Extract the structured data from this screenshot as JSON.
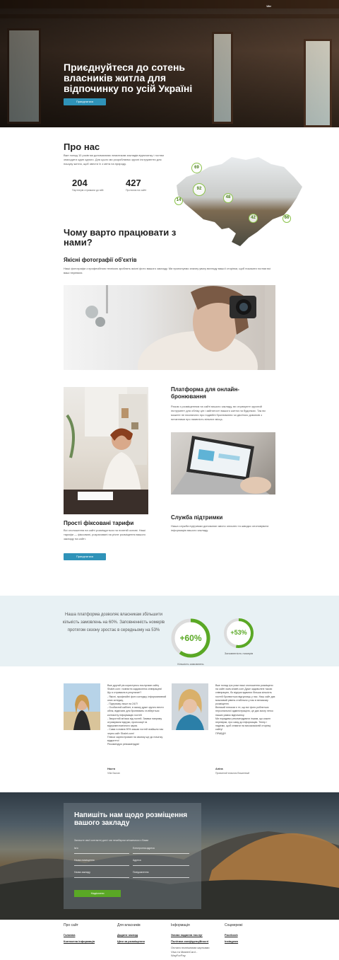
{
  "hero": {
    "lang": "Ukr",
    "title": "Приєднуйтеся до сотень власників житла для відпочинку по усій Україні",
    "button": "Приєднатися"
  },
  "about": {
    "title": "Про нас",
    "text": "Вже понад 10 років ми допомагаємо власникам закладів відпочинку і гостям знаходити один одного. Для цього ми розробляємо зручні інструменти для пошуку житла, щоб звести їх з мета на природу.",
    "stats": [
      {
        "num": "204",
        "label": "Партнерів отримали до війі"
      },
      {
        "num": "427",
        "label": "Протягом на сайті"
      }
    ],
    "map_bubbles": [
      "69",
      "92",
      "14",
      "48",
      "42",
      "66"
    ]
  },
  "why": {
    "title": "Чому варто працювати з нами?",
    "features": [
      {
        "title": "Якісні фотографії об'єктів",
        "text": "Наші фотографи з професійною технікою зроблять якісні фото вашого закладу. Ми пропонуємо значну увагу вигляду вашої сторінки, щоб показати гостям всі ваші переваги."
      },
      {
        "title": "Платформа для онлайн-бронювання",
        "text": "Разом з розміщенням на сайті вашого закладу, ви отримуєте зручний інструмент для обліку цін і зайнятості вашого житла на будинках. Так ви можете не вхиляпати про подвійні бронювання чи двоїткис дзвонків з питаннями про наявність вільних місць."
      },
      {
        "title": "Прості фіксовані тарифи",
        "text": "Всі оголошення на сайті розміщується на платній основі. Наші тарифи — фіксовані, розраховані на річне розміщення вашого закладу на сайті.",
        "button": "Приєднатися"
      },
      {
        "title": "Служба підтримки",
        "text": "Наша служба підтримки допомагає якісно описати та швидко опоновувати інформацію вашого закладу."
      }
    ]
  },
  "band": {
    "text": "Наша платформа дозволяє власникам збільшити кількість замовлень на 60%. Заповненність номерів протягом сезону зростає в середньому на 53%",
    "gauges": [
      {
        "value": "+60%",
        "fraction": 0.6,
        "caption": "Кількість замовлень"
      },
      {
        "value": "+53%",
        "fraction": 0.53,
        "caption": "Заповненість номерів"
      }
    ],
    "colors": {
      "accent": "#5aa825",
      "track": "#dcdcdc"
    }
  },
  "testimonials": [
    {
      "text": "Вже другий рік користуюсь послугами сайту Shalet.com і повністю задоволена співпрацею!\nЩо я отримала в результаті?\n- Якісні, професійні фото котеджу, інформативний опис котеджу,\n- Підтримку лише на 24/7!\n- Особистий кабінет, в якому дуже зручно вести облік, відвічати для бронювань та вберіться контактну інформацію гостей\n- Зворотній зв'язок від гостей. Заявки напряму отримували відгуки, пропозиції та відгукаєпломічного зараз.\n- Сама головна 90% зашаи гостей знайшли нас через сайт Shalet.com!\nПлюси зареєстровані на своєму ще до початку відкриття!\nРекомендую ревокмендую!",
      "name": "Настя",
      "role": "Villa Sacran"
    },
    {
      "text": "Вже понад три роки наші оголошення розміщено на сайті www.shalet.com Дуже задоволені такою співпрацею, бо відгуки вдачних більша кількість гостей бронюється відгуклиць у нас. Наш сайт дає можливий рівень стабільно у нас в великому розміщенні.\nВеликий плюсом є те, що всі фото робляться персональної адміністрацією, це дає змогу легко наших рамок відпочинку.\nМи порадимо рекомендувати іншим, що кожен перевіряє, про саму до інформацію. Тепер і надіємо, щоб ставати на високоякісній сторінці сайту!\nПРАВДУ!",
      "name": "Аліна",
      "role": "Приватний власник Вишневый"
    }
  ],
  "contact": {
    "title": "Напишіть нам щодо розміщення вашого закладу",
    "subtitle": "Залиште свої контактні дані і ми незабаром зв'яжемося з Вами",
    "fields": [
      "Ім'я",
      "Електронна адреса",
      "Назва помещення",
      "Адреса",
      "Назва закладу",
      "Повідомлення"
    ],
    "button": "Надіслати"
  },
  "footer": {
    "columns": [
      {
        "head": "Про сайт",
        "links": [
          "Головна",
          "Контактна інформація"
        ]
      },
      {
        "head": "Для власників",
        "links": [
          "Додати заклад",
          "Ціни за розміщення"
        ]
      },
      {
        "head": "Інформація",
        "links": [
          "Умови надання послуг",
          "Політика конфіденційності"
        ],
        "note": "Оплата платіжними картками Visa та MasterCard - WayForPay"
      },
      {
        "head": "Соцмережі",
        "links": [
          "Facebook",
          "Instagram"
        ]
      }
    ]
  }
}
